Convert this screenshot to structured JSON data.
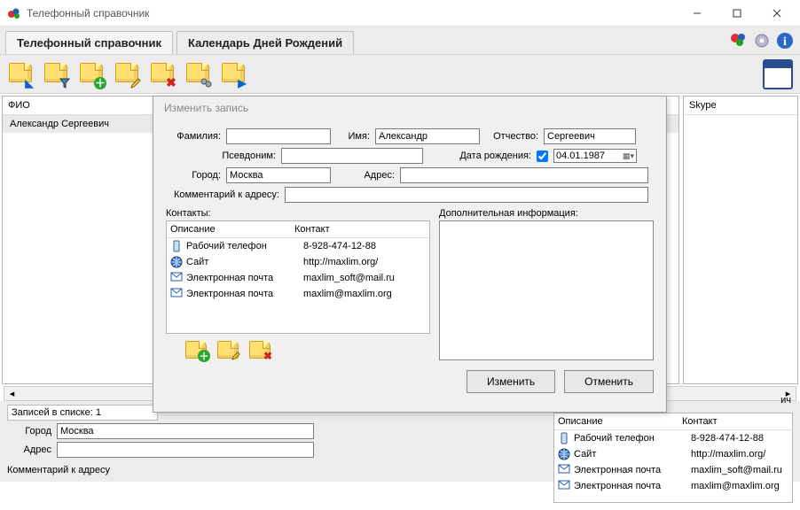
{
  "window": {
    "title": "Телефонный справочник"
  },
  "tabs": [
    {
      "label": "Телефонный справочник"
    },
    {
      "label": "Календарь Дней Рождений"
    }
  ],
  "left_col_header": "ФИО",
  "right_col_header": "Skype",
  "list": [
    "Александр Сергеевич"
  ],
  "status": "Записей в списке: 1",
  "bottom_form": {
    "city_label": "Город",
    "city_value": "Москва",
    "address_label": "Адрес",
    "address_value": "",
    "comment_label": "Комментарий к адресу"
  },
  "bg_contacts_headers": {
    "desc": "Описание",
    "contact": "Контакт"
  },
  "bg_contacts_trailing": "ич",
  "bg_contacts": [
    {
      "icon": "phone",
      "desc": "Рабочий телефон",
      "contact": "8-928-474-12-88"
    },
    {
      "icon": "globe",
      "desc": "Сайт",
      "contact": "http://maxlim.org/"
    },
    {
      "icon": "mail",
      "desc": "Электронная почта",
      "contact": "maxlim_soft@mail.ru"
    },
    {
      "icon": "mail",
      "desc": "Электронная почта",
      "contact": "maxlim@maxlim.org"
    }
  ],
  "dialog": {
    "title": "Изменить запись",
    "labels": {
      "surname": "Фамилия:",
      "name": "Имя:",
      "patronymic": "Отчество:",
      "nickname": "Псевдоним:",
      "dob": "Дата рождения:",
      "city": "Город:",
      "address": "Адрес:",
      "addr_comment": "Комментарий к адресу:",
      "contacts": "Контакты:",
      "extra": "Дополнительная информация:"
    },
    "values": {
      "surname": "",
      "name": "Александр",
      "patronymic": "Сергеевич",
      "nickname": "",
      "dob_checked": true,
      "dob": "04.01.1987",
      "city": "Москва",
      "address": "",
      "addr_comment": "",
      "extra": ""
    },
    "contacts_headers": {
      "desc": "Описание",
      "contact": "Контакт"
    },
    "contacts": [
      {
        "icon": "phone",
        "desc": "Рабочий телефон",
        "contact": "8-928-474-12-88"
      },
      {
        "icon": "globe",
        "desc": "Сайт",
        "contact": "http://maxlim.org/"
      },
      {
        "icon": "mail",
        "desc": "Электронная почта",
        "contact": "maxlim_soft@mail.ru"
      },
      {
        "icon": "mail",
        "desc": "Электронная почта",
        "contact": "maxlim@maxlim.org"
      }
    ],
    "buttons": {
      "ok": "Изменить",
      "cancel": "Отменить"
    }
  },
  "icons": {
    "balloons": "balloons-icon",
    "gear": "gear-icon",
    "info": "info-icon",
    "calendar": "calendar-icon"
  }
}
